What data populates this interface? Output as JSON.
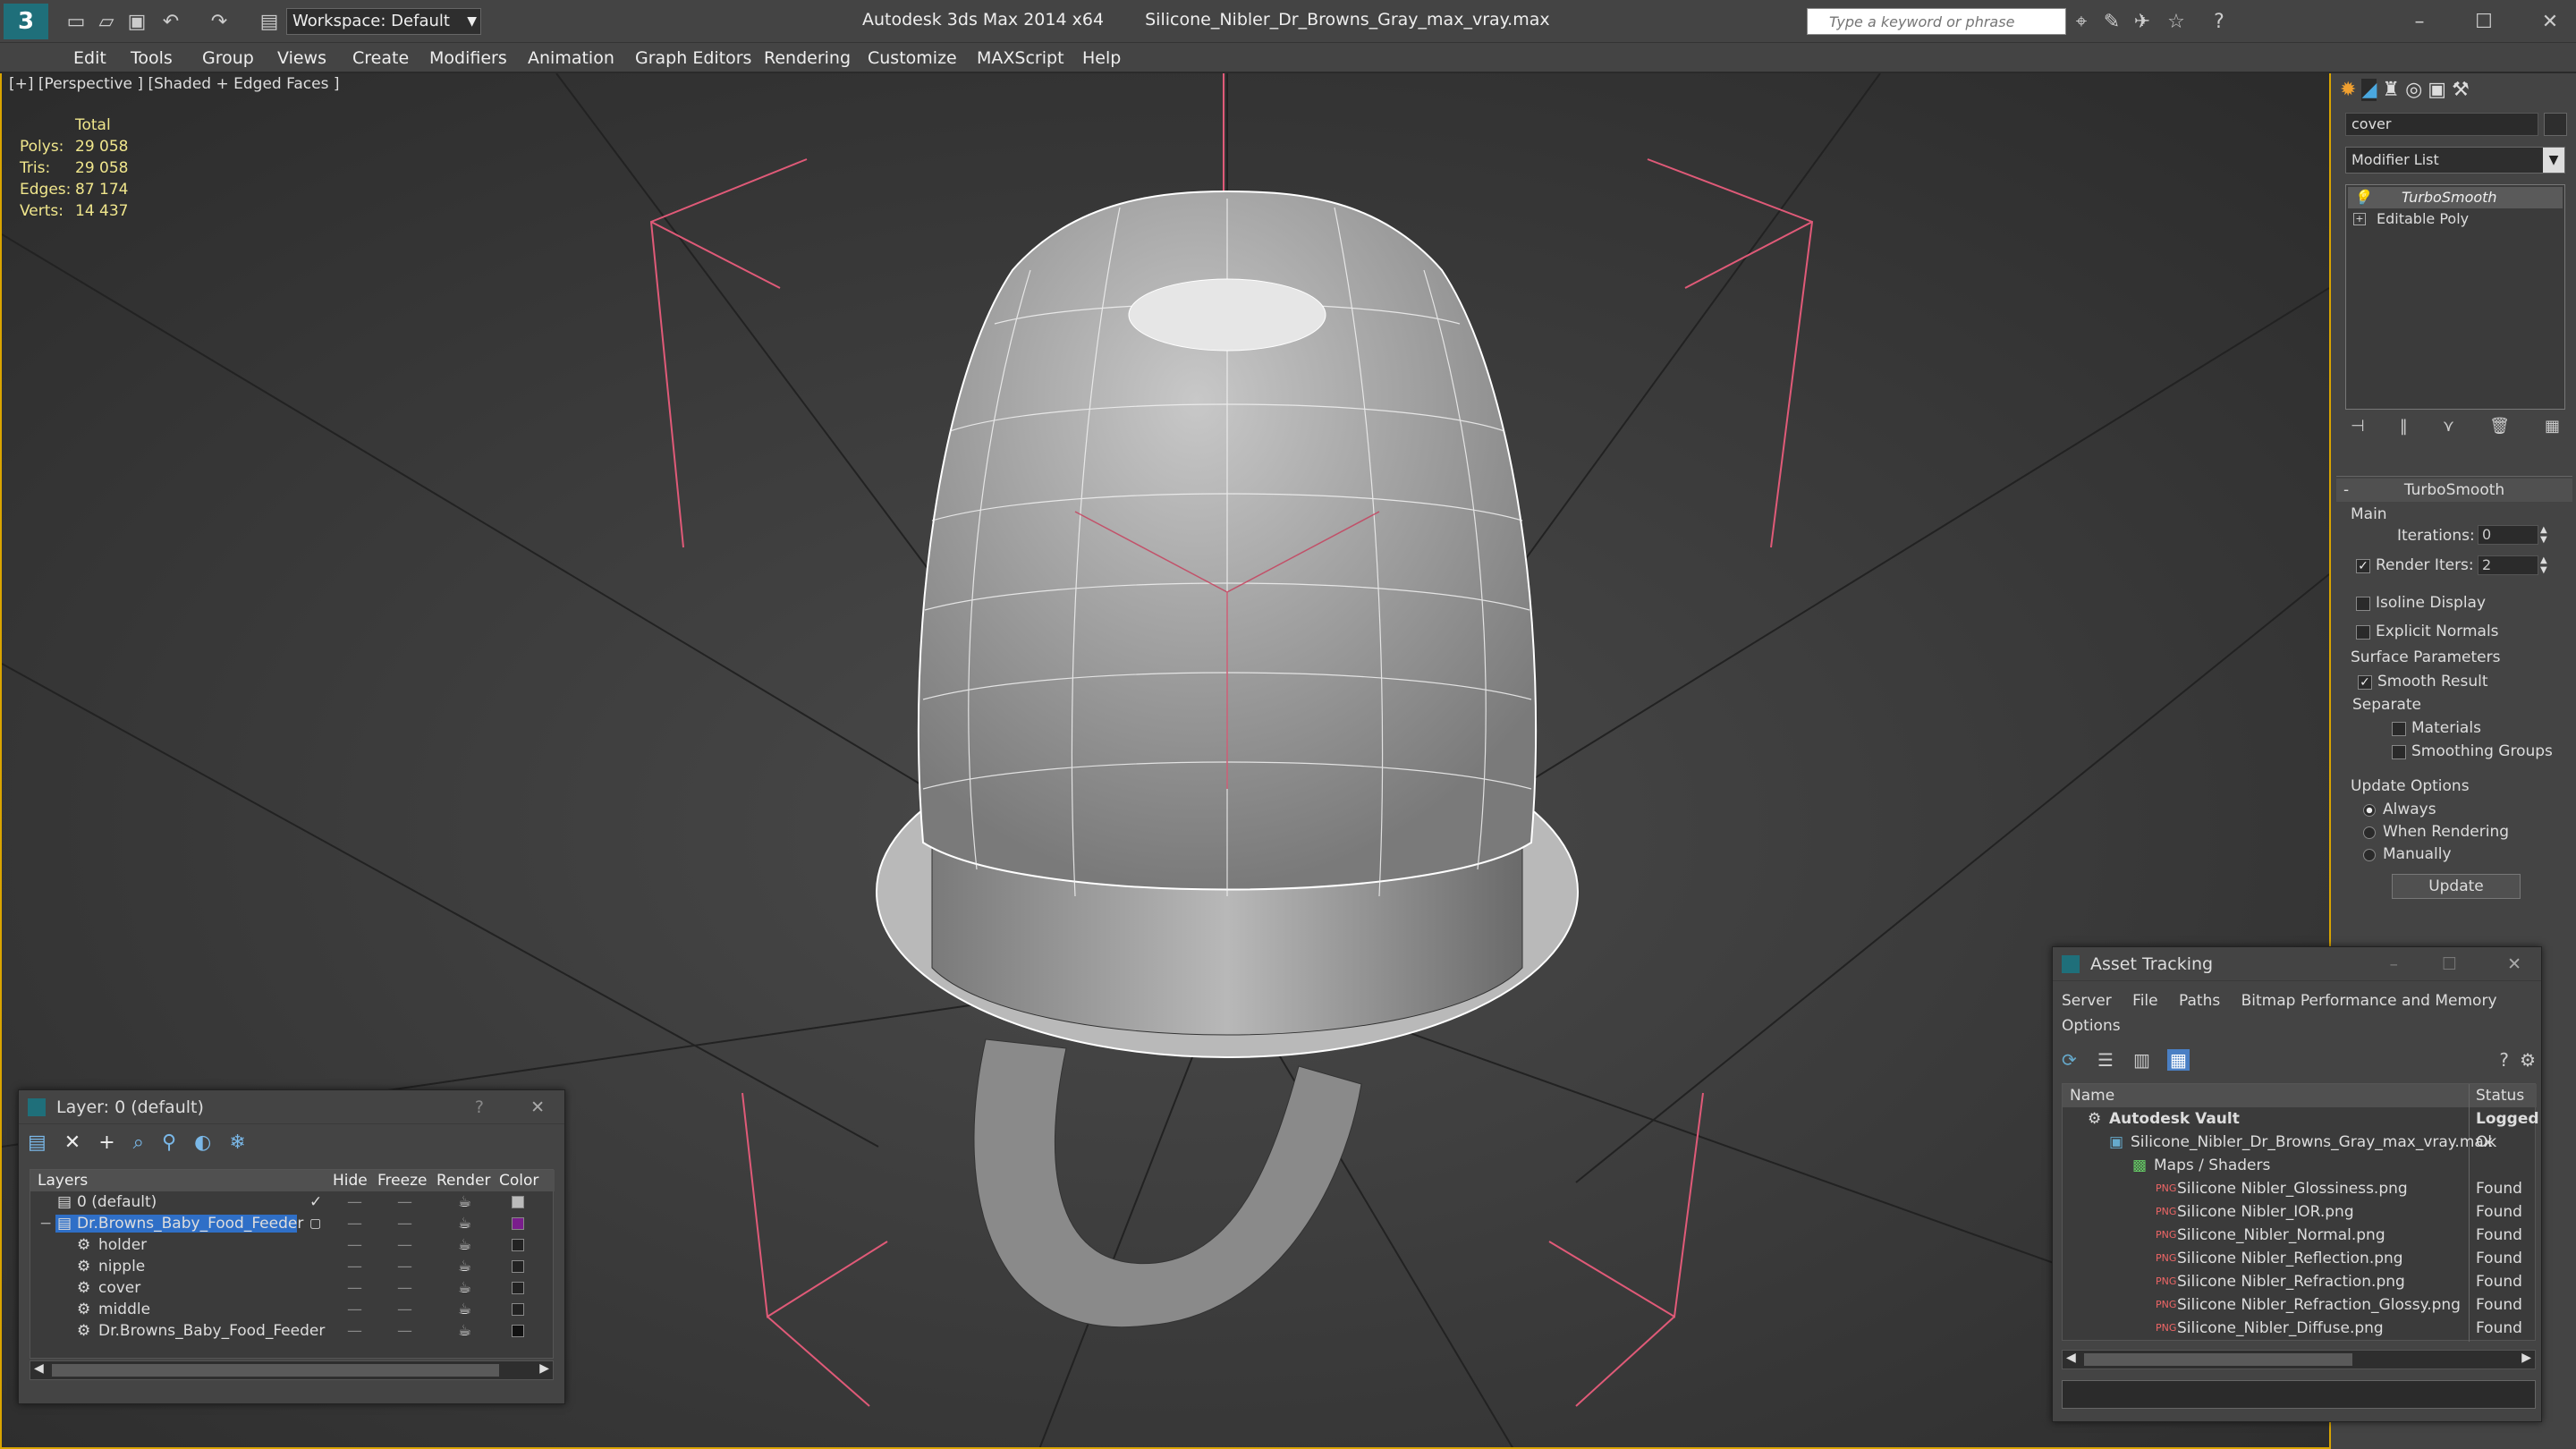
{
  "app": {
    "title": "Autodesk 3ds Max  2014 x64",
    "filename": "Silicone_Nibler_Dr_Browns_Gray_max_vray.max",
    "workspace": "Workspace: Default",
    "search_placeholder": "Type a keyword or phrase",
    "accent_color": "#d9a400"
  },
  "menu": [
    "Edit",
    "Tools",
    "Group",
    "Views",
    "Create",
    "Modifiers",
    "Animation",
    "Graph Editors",
    "Rendering",
    "Customize",
    "MAXScript",
    "Help"
  ],
  "viewport": {
    "label": "[+] [Perspective ] [Shaded + Edged Faces ]",
    "stats_header": "Total",
    "stats": [
      {
        "label": "Polys:",
        "value": "29 058"
      },
      {
        "label": "Tris:",
        "value": "29 058"
      },
      {
        "label": "Edges:",
        "value": "87 174"
      },
      {
        "label": "Verts:",
        "value": "14 437"
      }
    ]
  },
  "command_panel": {
    "object_name": "cover",
    "modifier_list": "Modifier List",
    "stack": [
      "TurboSmooth",
      "Editable Poly"
    ],
    "rollout_title": "TurboSmooth",
    "main_group": "Main",
    "iterations_label": "Iterations:",
    "iterations_value": "0",
    "render_iters_label": "Render Iters:",
    "render_iters_value": "2",
    "isoline_label": "Isoline Display",
    "explicit_normals_label": "Explicit Normals",
    "surface_params_label": "Surface Parameters",
    "smooth_result_label": "Smooth Result",
    "separate_label": "Separate",
    "materials_label": "Materials",
    "smoothing_groups_label": "Smoothing Groups",
    "update_options_label": "Update Options",
    "always_label": "Always",
    "when_rendering_label": "When Rendering",
    "manually_label": "Manually",
    "update_button": "Update"
  },
  "layer_window": {
    "title": "Layer: 0 (default)",
    "help": "?",
    "columns": [
      "Layers",
      "Hide",
      "Freeze",
      "Render",
      "Color"
    ],
    "rows": [
      {
        "name": "0 (default)",
        "color": "#bbbbbb"
      },
      {
        "name": "Dr.Browns_Baby_Food_Feeder",
        "color": "#7a1e8c"
      },
      {
        "name": "holder",
        "color": "#222222"
      },
      {
        "name": "nipple",
        "color": "#222222"
      },
      {
        "name": "cover",
        "color": "#222222"
      },
      {
        "name": "middle",
        "color": "#222222"
      },
      {
        "name": "Dr.Browns_Baby_Food_Feeder",
        "color": "#111111"
      }
    ]
  },
  "asset_window": {
    "title": "Asset Tracking",
    "menu": [
      "Server",
      "File",
      "Paths",
      "Bitmap Performance and Memory",
      "Options"
    ],
    "columns": [
      "Name",
      "Status"
    ],
    "rows": [
      {
        "name": "Autodesk Vault",
        "status": "Logged"
      },
      {
        "name": "Silicone_Nibler_Dr_Browns_Gray_max_vray.max",
        "status": "Ok"
      },
      {
        "name": "Maps / Shaders",
        "status": ""
      },
      {
        "name": "Silicone Nibler_Glossiness.png",
        "status": "Found"
      },
      {
        "name": "Silicone Nibler_IOR.png",
        "status": "Found"
      },
      {
        "name": "Silicone_Nibler_Normal.png",
        "status": "Found"
      },
      {
        "name": "Silicone Nibler_Reflection.png",
        "status": "Found"
      },
      {
        "name": "Silicone Nibler_Refraction.png",
        "status": "Found"
      },
      {
        "name": "Silicone Nibler_Refraction_Glossy.png",
        "status": "Found"
      },
      {
        "name": "Silicone_Nibler_Diffuse.png",
        "status": "Found"
      }
    ]
  }
}
